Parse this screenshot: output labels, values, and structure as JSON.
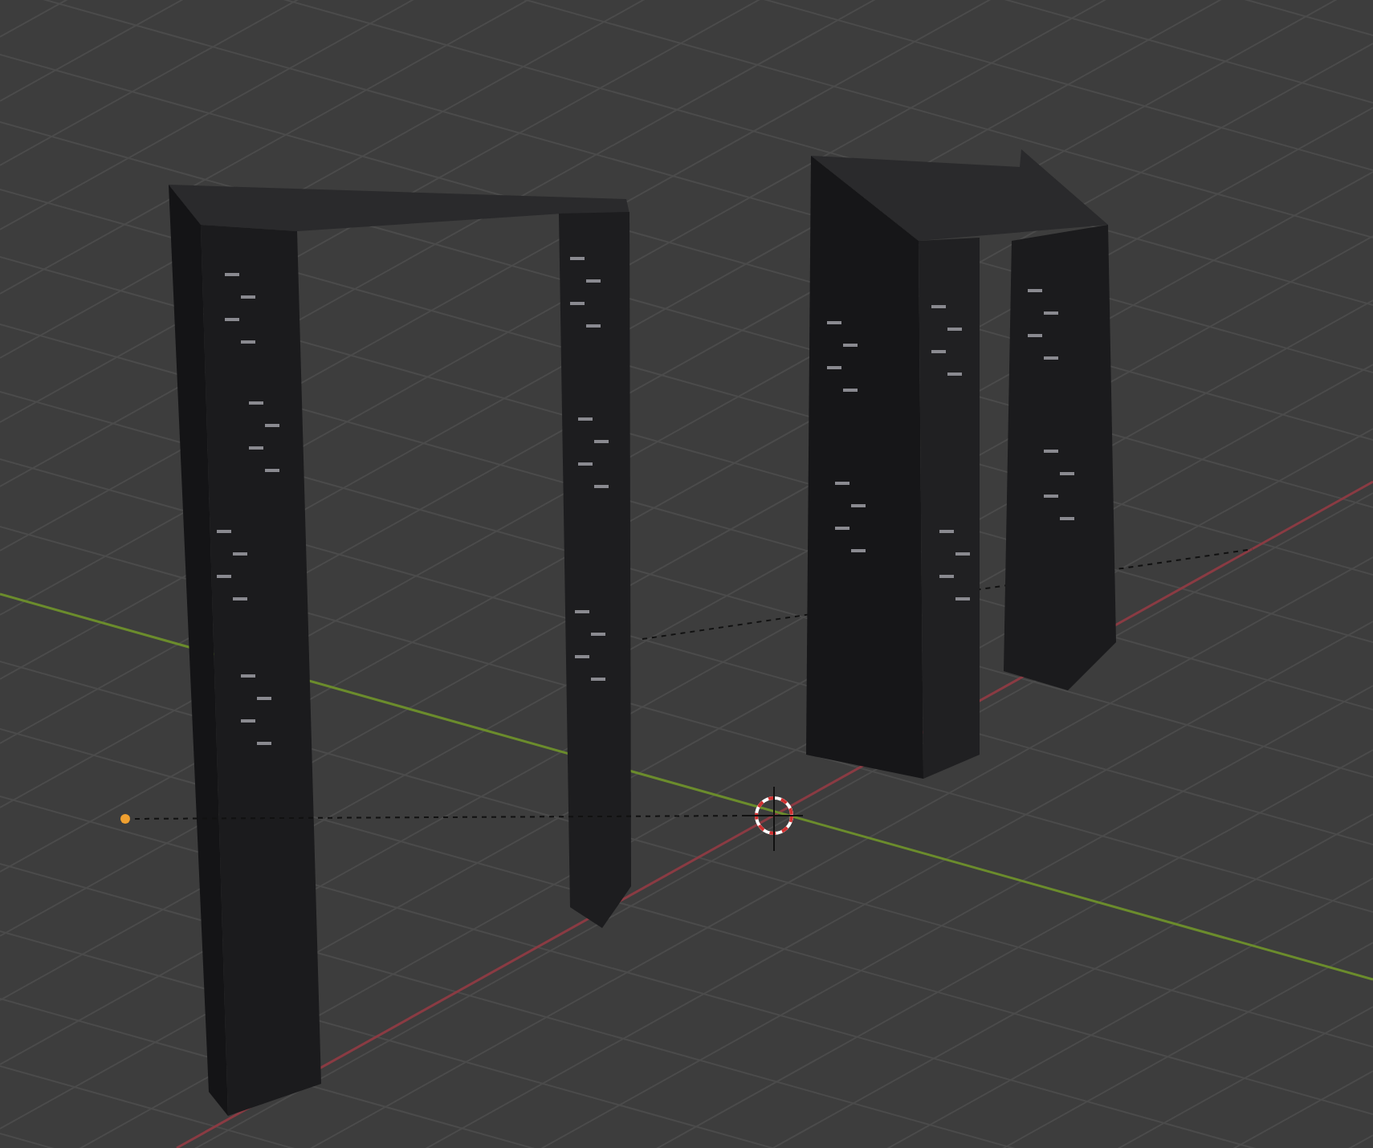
{
  "viewport": {
    "objects": [
      {
        "selected": false
      },
      {
        "selected": false
      }
    ]
  }
}
